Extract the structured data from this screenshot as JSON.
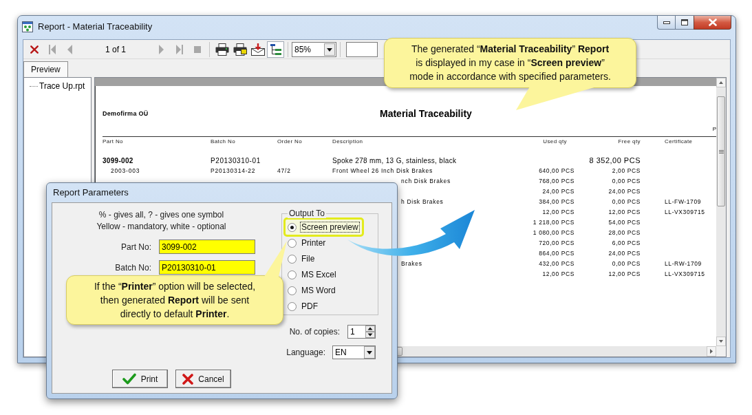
{
  "window": {
    "title": "Report - Material Traceability"
  },
  "toolbar": [
    {
      "kind": "close",
      "disabled": false,
      "pressed": false
    },
    {
      "kind": "first",
      "disabled": true,
      "pressed": false
    },
    {
      "kind": "previous",
      "disabled": true,
      "pressed": false
    },
    {
      "kind": "page_counter",
      "text": "1 of 1"
    },
    {
      "kind": "next",
      "disabled": true,
      "pressed": false
    },
    {
      "kind": "last",
      "disabled": true,
      "pressed": false
    },
    {
      "kind": "stop",
      "disabled": true,
      "pressed": false
    },
    {
      "kind": "separator"
    },
    {
      "kind": "print",
      "disabled": false,
      "pressed": false
    },
    {
      "kind": "print_setup",
      "disabled": false,
      "pressed": false
    },
    {
      "kind": "export",
      "disabled": false,
      "pressed": false
    },
    {
      "kind": "group_tree",
      "disabled": false,
      "pressed": true
    },
    {
      "kind": "separator"
    },
    {
      "kind": "zoom",
      "value": "85%"
    },
    {
      "kind": "separator"
    },
    {
      "kind": "search_field"
    }
  ],
  "tabs": [
    {
      "label": "Preview",
      "selected": true
    }
  ],
  "tree": [
    {
      "label": "Trace Up.rpt"
    }
  ],
  "report": {
    "company": "Demofirma OÜ",
    "title": "Material Traceability",
    "header_fragment": "P",
    "columns": [
      "Part No",
      "Batch No",
      "Order No",
      "Description",
      "Used qty",
      "Free qty",
      "Certificate"
    ],
    "rows": [
      {
        "kind": "main",
        "part_no": "3099-002",
        "batch_no": "P20130310-01",
        "description": "Spoke 278 mm, 13 G, stainless, black",
        "free_qty": "8 352,00 PCS"
      },
      {
        "kind": "detail",
        "part_no": "2003-003",
        "batch_no": "P20130314-22",
        "order_no": "47/2",
        "description": "Front Wheel 26 Inch Disk Brakes",
        "used_qty": "640,00 PCS",
        "free_qty": "2,00 PCS"
      },
      {
        "kind": "partial",
        "description": "nch Disk Brakes",
        "used_qty": "768,00 PCS",
        "free_qty": "0,00 PCS"
      },
      {
        "kind": "partial",
        "used_qty": "24,00 PCS",
        "free_qty": "24,00 PCS"
      },
      {
        "kind": "partial",
        "description": "h Disk Brakes",
        "used_qty": "384,00 PCS",
        "free_qty": "0,00 PCS",
        "certificate": "LL-FW-1709"
      },
      {
        "kind": "partial",
        "used_qty": "12,00 PCS",
        "free_qty": "12,00 PCS",
        "certificate": "LL-VX309715"
      },
      {
        "kind": "partial",
        "used_qty": "1 218,00 PCS",
        "free_qty": "54,00 PCS"
      },
      {
        "kind": "partial",
        "used_qty": "1 080,00 PCS",
        "free_qty": "28,00 PCS"
      },
      {
        "kind": "partial",
        "used_qty": "720,00 PCS",
        "free_qty": "6,00 PCS"
      },
      {
        "kind": "partial",
        "used_qty": "864,00 PCS",
        "free_qty": "24,00 PCS"
      },
      {
        "kind": "partial",
        "description": "Brakes",
        "used_qty": "432,00 PCS",
        "free_qty": "0,00 PCS",
        "certificate": "LL-RW-1709"
      },
      {
        "kind": "partial",
        "used_qty": "12,00 PCS",
        "free_qty": "12,00 PCS",
        "certificate": "LL-VX309715"
      }
    ]
  },
  "dialog": {
    "title": "Report Parameters",
    "hint_lines": [
      "% - gives all, ? - gives one symbol",
      "Yellow - mandatory, white - optional"
    ],
    "fields": [
      {
        "label": "Part No:",
        "value": "3099-002",
        "required": true
      },
      {
        "label": "Batch No:",
        "value": "P20130310-01",
        "required": true
      }
    ],
    "output_to": {
      "label": "Output To",
      "options": [
        {
          "label": "Screen preview",
          "selected": true,
          "highlighted": true
        },
        {
          "label": "Printer",
          "selected": false,
          "highlighted": false
        },
        {
          "label": "File",
          "selected": false,
          "highlighted": false
        },
        {
          "label": "MS Excel",
          "selected": false,
          "highlighted": false
        },
        {
          "label": "MS Word",
          "selected": false,
          "highlighted": false
        },
        {
          "label": "PDF",
          "selected": false,
          "highlighted": false
        }
      ]
    },
    "copies": {
      "label": "No. of copies:",
      "value": "1"
    },
    "language": {
      "label": "Language:",
      "value": "EN"
    },
    "buttons": [
      {
        "kind": "print",
        "label": "Print"
      },
      {
        "kind": "cancel",
        "label": "Cancel"
      }
    ]
  },
  "callouts": [
    {
      "kind": "report_note",
      "text": "The generated “**Material Traceability**” **Report**\nis displayed in my case in “**Screen preview**”\nmode in accordance with specified parameters."
    },
    {
      "kind": "printer_note",
      "text": "If the “**Printer**” option will be selected,\nthen generated **Report** will be sent\ndirectly to default **Printer**."
    }
  ]
}
